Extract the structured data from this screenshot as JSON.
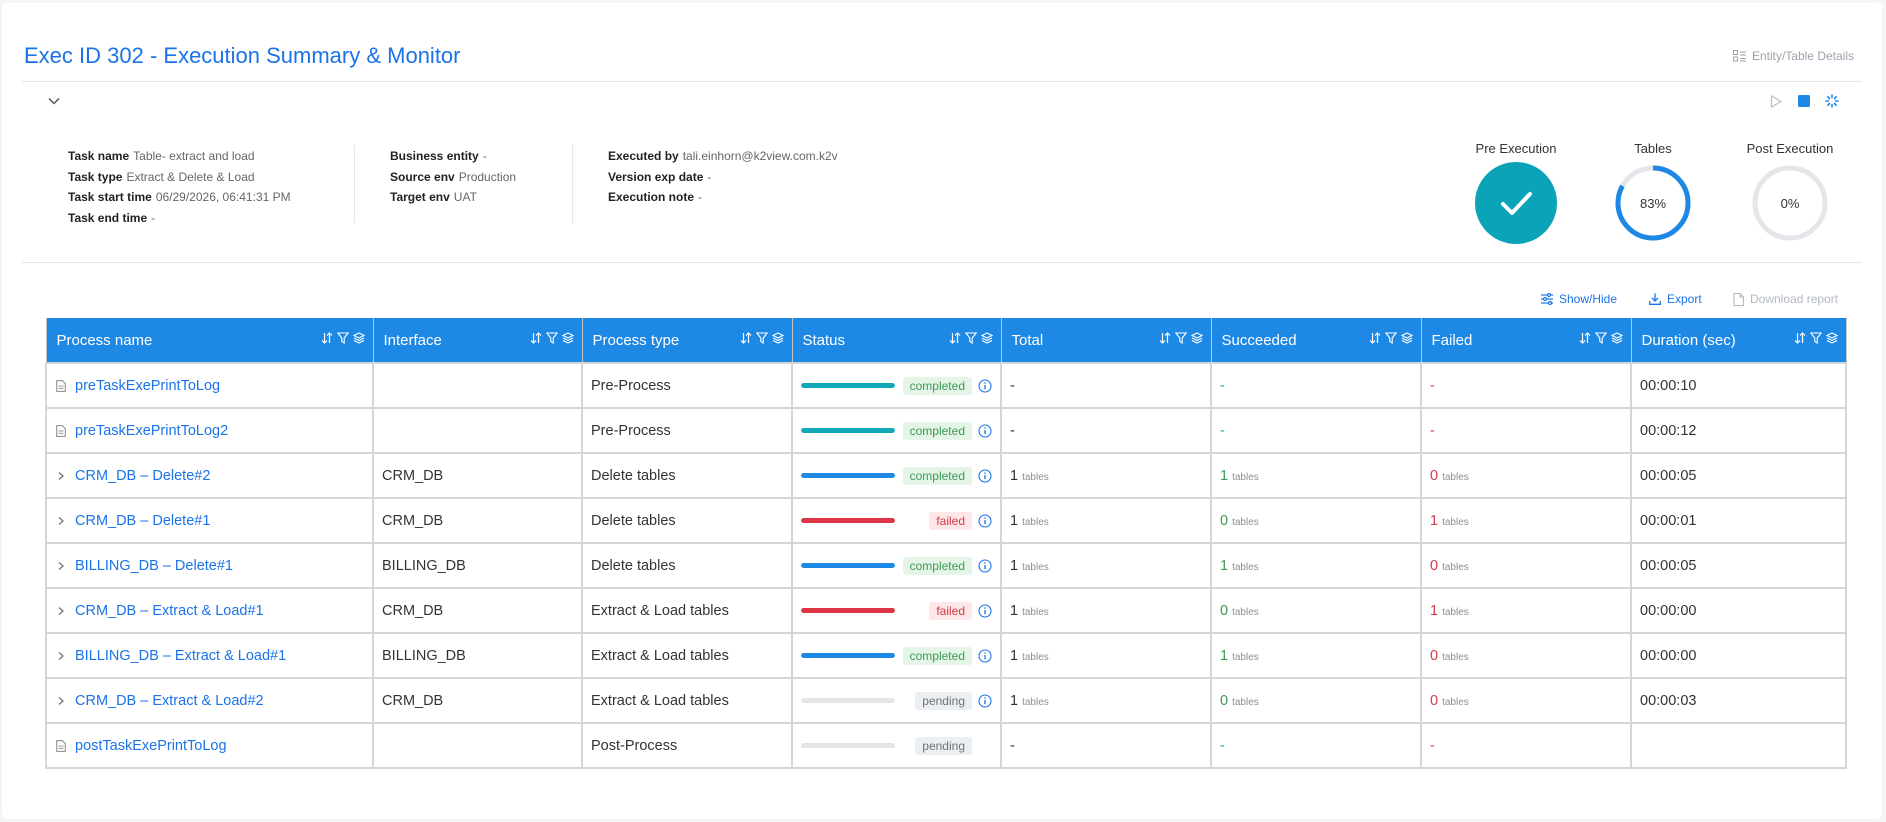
{
  "header": {
    "title": "Exec ID 302 - Execution Summary & Monitor",
    "entity_link": "Entity/Table Details"
  },
  "task_info": {
    "col1": [
      {
        "label": "Task name",
        "value": "Table- extract and load"
      },
      {
        "label": "Task type",
        "value": "Extract & Delete & Load"
      },
      {
        "label": "Task start time",
        "value": "06/29/2026, 06:41:31 PM"
      },
      {
        "label": "Task end time",
        "value": "-"
      }
    ],
    "col2": [
      {
        "label": "Business entity",
        "value": "-"
      },
      {
        "label": "Source env",
        "value": "Production"
      },
      {
        "label": "Target env",
        "value": "UAT"
      }
    ],
    "col3": [
      {
        "label": "Executed by",
        "value": "tali.einhorn@k2view.com.k2v"
      },
      {
        "label": "Version exp date",
        "value": "-"
      },
      {
        "label": "Execution note",
        "value": "-"
      }
    ]
  },
  "gauges": {
    "pre": {
      "label": "Pre Execution",
      "color": "#0aa3b8"
    },
    "tables": {
      "label": "Tables",
      "text": "83%",
      "progress": 0.83,
      "color": "#1e88e5"
    },
    "post": {
      "label": "Post Execution",
      "text": "0%",
      "progress": 0
    }
  },
  "toolbar": {
    "show_hide": "Show/Hide",
    "export": "Export",
    "download": "Download report"
  },
  "table": {
    "columns": [
      "Process name",
      "Interface",
      "Process type",
      "Status",
      "Total",
      "Succeeded",
      "Failed",
      "Duration (sec)"
    ],
    "unit_label": "tables",
    "rows": [
      {
        "name": "preTaskExePrintToLog",
        "lead": "doc",
        "interface": "",
        "type": "Pre-Process",
        "status": "completed",
        "bar_color": "#13a8b5",
        "progress": 1,
        "info": true,
        "total": "-",
        "succeeded": "-",
        "failed": "-",
        "has_units": false,
        "duration": "00:00:10"
      },
      {
        "name": "preTaskExePrintToLog2",
        "lead": "doc",
        "interface": "",
        "type": "Pre-Process",
        "status": "completed",
        "bar_color": "#13a8b5",
        "progress": 1,
        "info": true,
        "total": "-",
        "succeeded": "-",
        "failed": "-",
        "has_units": false,
        "duration": "00:00:12"
      },
      {
        "name": "CRM_DB – Delete#2",
        "lead": "chevron",
        "interface": "CRM_DB",
        "type": "Delete tables",
        "status": "completed",
        "bar_color": "#1e88e5",
        "progress": 1,
        "info": true,
        "total": "1",
        "succeeded": "1",
        "failed": "0",
        "has_units": true,
        "duration": "00:00:05"
      },
      {
        "name": "CRM_DB – Delete#1",
        "lead": "chevron",
        "interface": "CRM_DB",
        "type": "Delete tables",
        "status": "failed",
        "bar_color": "#dc3545",
        "progress": 1,
        "info": true,
        "total": "1",
        "succeeded": "0",
        "failed": "1",
        "has_units": true,
        "duration": "00:00:01"
      },
      {
        "name": "BILLING_DB – Delete#1",
        "lead": "chevron",
        "interface": "BILLING_DB",
        "type": "Delete tables",
        "status": "completed",
        "bar_color": "#1e88e5",
        "progress": 1,
        "info": true,
        "total": "1",
        "succeeded": "1",
        "failed": "0",
        "has_units": true,
        "duration": "00:00:05"
      },
      {
        "name": "CRM_DB – Extract & Load#1",
        "lead": "chevron",
        "interface": "CRM_DB",
        "type": "Extract & Load tables",
        "status": "failed",
        "bar_color": "#dc3545",
        "progress": 1,
        "info": true,
        "total": "1",
        "succeeded": "0",
        "failed": "1",
        "has_units": true,
        "duration": "00:00:00"
      },
      {
        "name": "BILLING_DB – Extract & Load#1",
        "lead": "chevron",
        "interface": "BILLING_DB",
        "type": "Extract & Load tables",
        "status": "completed",
        "bar_color": "#1e88e5",
        "progress": 1,
        "info": true,
        "total": "1",
        "succeeded": "1",
        "failed": "0",
        "has_units": true,
        "duration": "00:00:00"
      },
      {
        "name": "CRM_DB – Extract & Load#2",
        "lead": "chevron",
        "interface": "CRM_DB",
        "type": "Extract & Load tables",
        "status": "pending",
        "bar_color": "#e5e5e5",
        "progress": 0,
        "info": true,
        "total": "1",
        "succeeded": "0",
        "failed": "0",
        "has_units": true,
        "duration": "00:00:03"
      },
      {
        "name": "postTaskExePrintToLog",
        "lead": "doc",
        "interface": "",
        "type": "Post-Process",
        "status": "pending",
        "bar_color": "#e5e5e5",
        "progress": 0,
        "info": false,
        "total": "-",
        "succeeded": "-",
        "failed": "-",
        "has_units": false,
        "duration": ""
      }
    ]
  }
}
